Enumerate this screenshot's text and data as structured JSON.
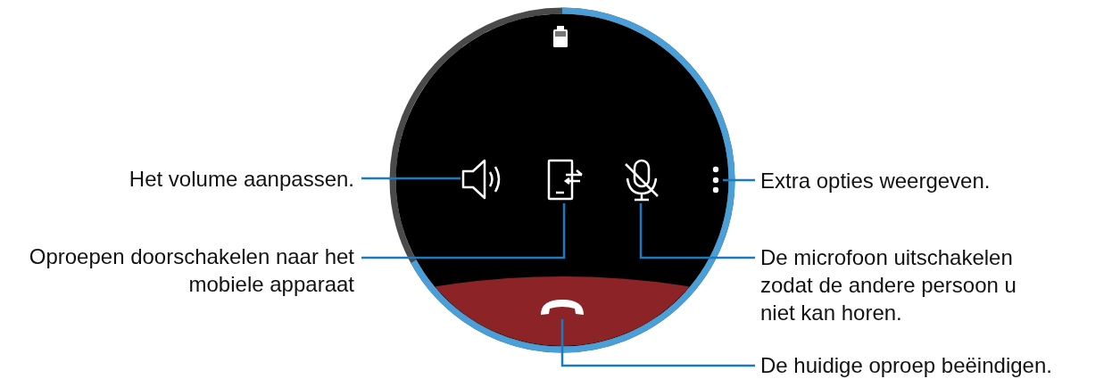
{
  "watch": {
    "call_progress": {
      "level": 0.67
    }
  },
  "callouts": [
    {
      "kind": "volume",
      "text": "Het volume aanpassen."
    },
    {
      "kind": "transfer",
      "text": "Oproepen doorschakelen naar het mobiele apparaat"
    },
    {
      "kind": "more",
      "text": "Extra opties weergeven."
    },
    {
      "kind": "mute",
      "text": "De microfoon uitschakelen zodat de andere persoon u niet kan horen."
    },
    {
      "kind": "end_call",
      "text": "De huidige oproep beëindigen."
    }
  ]
}
